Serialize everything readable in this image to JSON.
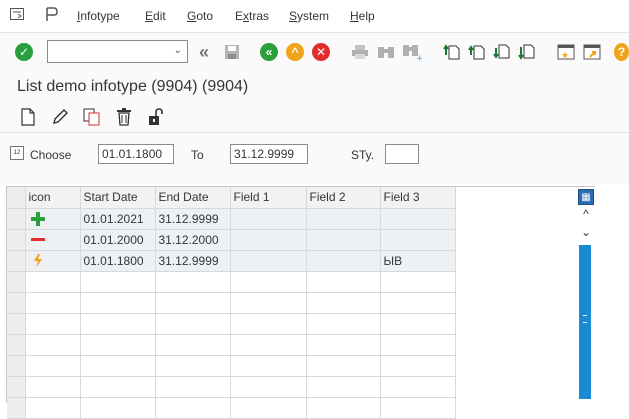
{
  "menubar": {
    "items": [
      {
        "label": "Infotype",
        "key": "I"
      },
      {
        "label": "Edit",
        "key": "E"
      },
      {
        "label": "Goto",
        "key": "G"
      },
      {
        "label": "Extras",
        "key": "x"
      },
      {
        "label": "System",
        "key": "S"
      },
      {
        "label": "Help",
        "key": "H"
      }
    ]
  },
  "toolbar": {
    "command_field_value": "",
    "icons": [
      "enter-icon",
      "back-double-icon",
      "save-icon",
      "back-icon",
      "exit-icon",
      "cancel-icon",
      "print-icon",
      "find-icon",
      "find-next-icon",
      "first-page-icon",
      "previous-page-icon",
      "next-page-icon",
      "last-page-icon",
      "new-session-icon",
      "shortcut-icon",
      "help-icon"
    ]
  },
  "page": {
    "title": "List demo infotype (9904) (9904)"
  },
  "app_toolbar": {
    "icons": [
      "create-icon",
      "change-icon",
      "copy-icon",
      "delete-icon",
      "lock-icon"
    ]
  },
  "selection": {
    "choose_label": "Choose",
    "from_value": "01.01.1800",
    "to_label": "To",
    "to_value": "31.12.9999",
    "sty_label": "STy.",
    "sty_value": ""
  },
  "grid": {
    "columns": [
      "icon",
      "Start Date",
      "End Date",
      "Field 1",
      "Field 2",
      "Field 3"
    ],
    "rows": [
      {
        "icon": "plus-icon",
        "icon_color": "#2b9e3e",
        "start": "01.01.2021",
        "end": "31.12.9999",
        "f1": "",
        "f2": "",
        "f3": ""
      },
      {
        "icon": "minus-icon",
        "icon_color": "#e02e2e",
        "start": "01.01.2000",
        "end": "31.12.2000",
        "f1": "",
        "f2": "",
        "f3": ""
      },
      {
        "icon": "lightning-icon",
        "icon_color": "#f0a419",
        "start": "01.01.1800",
        "end": "31.12.9999",
        "f1": "",
        "f2": "",
        "f3": "ЫВ"
      }
    ]
  }
}
